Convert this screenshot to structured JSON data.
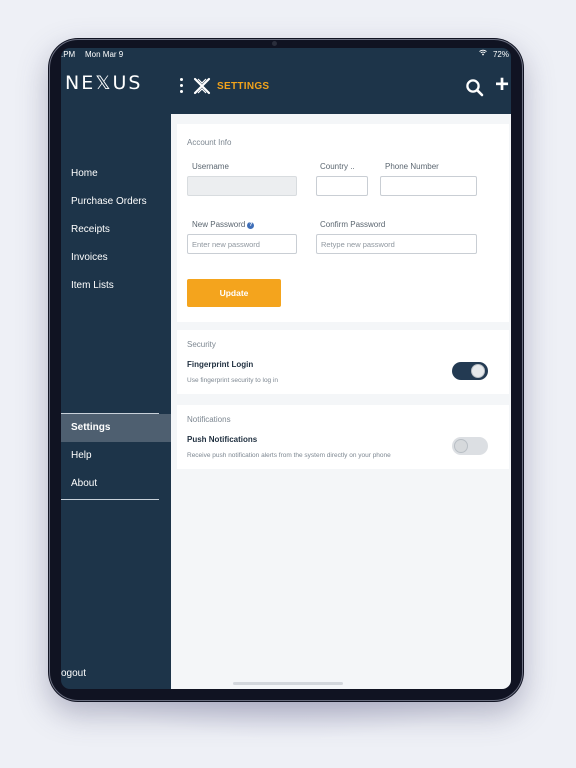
{
  "status_bar": {
    "time": ".PM",
    "date": "Mon Mar 9",
    "battery": "72%"
  },
  "app": {
    "logo": "NE𝕏US",
    "page_title": "SETTINGS"
  },
  "sidebar": {
    "items": [
      {
        "label": "Home"
      },
      {
        "label": "Purchase Orders"
      },
      {
        "label": "Receipts"
      },
      {
        "label": "Invoices"
      },
      {
        "label": "Item Lists"
      }
    ],
    "bottom_items": [
      {
        "label": "Settings",
        "active": true
      },
      {
        "label": "Help"
      },
      {
        "label": "About"
      }
    ],
    "logout": "ogout"
  },
  "account_info": {
    "title": "Account Info",
    "username_label": "Username",
    "username_value": "",
    "country_label": "Country ..",
    "country_value": "",
    "phone_label": "Phone Number",
    "phone_value": "",
    "new_password_label": "New Password",
    "new_password_placeholder": "Enter new password",
    "confirm_password_label": "Confirm Password",
    "confirm_password_placeholder": "Retype new password",
    "update_button": "Update"
  },
  "security": {
    "title": "Security",
    "fingerprint_title": "Fingerprint Login",
    "fingerprint_desc": "Use fingerprint security to log in",
    "fingerprint_enabled": true
  },
  "notifications": {
    "title": "Notifications",
    "push_title": "Push Notifications",
    "push_desc": "Receive push notification alerts from the system directly on your phone",
    "push_enabled": false
  },
  "colors": {
    "sidebar_bg": "#1d3449",
    "accent": "#f4a41d",
    "active_nav_bg": "#4e5f70",
    "toggle_on": "#233a52"
  },
  "icons": [
    "menu-dots-icon",
    "nexus-x-icon",
    "search-icon",
    "plus-icon",
    "wifi-icon",
    "help-icon"
  ]
}
